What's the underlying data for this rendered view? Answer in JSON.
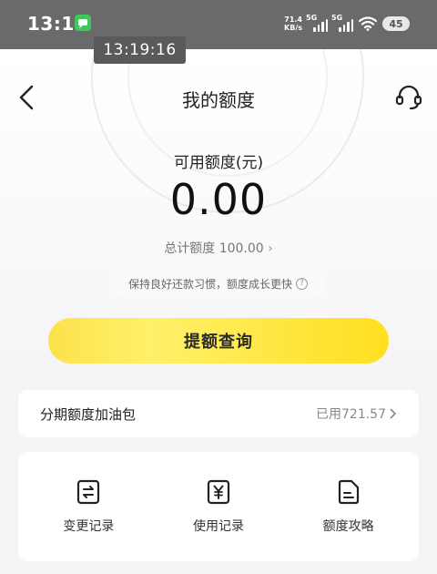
{
  "status_bar": {
    "time": "13:19",
    "net_speed_value": "71.4",
    "net_speed_unit": "KB/s",
    "signal1_label": "5G",
    "signal2_label": "5G",
    "battery": "45"
  },
  "overlay": {
    "time": "13:19:16"
  },
  "header": {
    "title": "我的额度",
    "back_icon": "chevron-left-icon",
    "service_icon": "headset-icon"
  },
  "credit": {
    "available_label": "可用额度(元)",
    "available_amount": "0.00",
    "total_label": "总计额度 100.00",
    "tip": "保持良好还款习惯，额度成长更快",
    "cta_label": "提额查询"
  },
  "fuel_pack": {
    "title": "分期额度加油包",
    "used": "已用721.57"
  },
  "tools": [
    {
      "label": "变更记录",
      "icon": "swap-record-icon"
    },
    {
      "label": "使用记录",
      "icon": "yuan-record-icon"
    },
    {
      "label": "额度攻略",
      "icon": "document-guide-icon"
    }
  ],
  "colors": {
    "accent_yellow": "#ffdf1f",
    "status_bar_bg": "#6a6a6a",
    "msg_icon_green": "#3ec95a"
  }
}
